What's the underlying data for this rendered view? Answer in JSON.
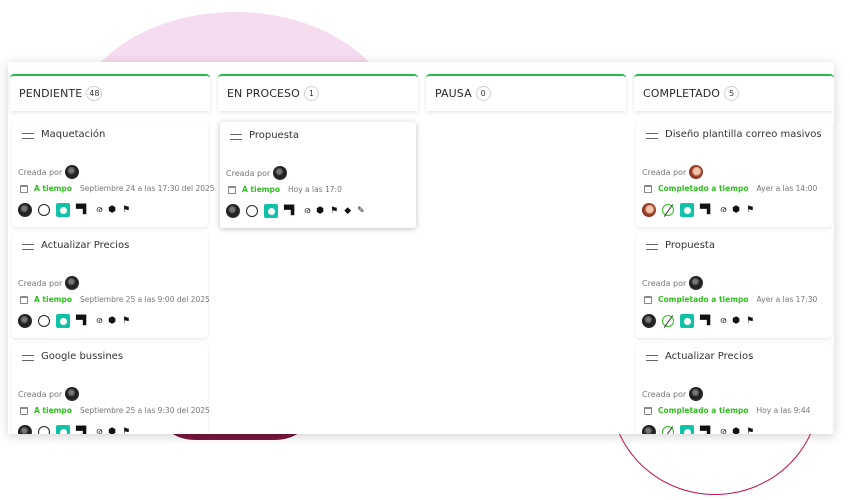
{
  "board": {
    "columns": [
      {
        "title": "PENDIENTE",
        "count": "48",
        "cards": [
          {
            "title": "Maquetación",
            "created_label": "Creada por",
            "status": "A tiempo",
            "date": "Septiembre 24 a las 17:30 del 2025",
            "completed": false
          },
          {
            "title": "Actualizar Precios",
            "created_label": "Creada por",
            "status": "A tiempo",
            "date": "Septiembre 25 a las 9:00 del 2025",
            "completed": false
          },
          {
            "title": "Google bussines",
            "created_label": "Creada por",
            "status": "A tiempo",
            "date": "Septiembre 25 a las 9:30 del 2025",
            "completed": false
          }
        ]
      },
      {
        "title": "EN PROCESO",
        "count": "1",
        "cards": [
          {
            "title": "Propuesta",
            "created_label": "Creada por",
            "status": "A tiempo",
            "date": "Hoy a las 17:0",
            "completed": false
          }
        ]
      },
      {
        "title": "PAUSA",
        "count": "0",
        "cards": []
      },
      {
        "title": "COMPLETADO",
        "count": "5",
        "cards": [
          {
            "title": "Diseño plantilla correo masivos",
            "created_label": "Creada por",
            "status": "Completado a tiempo",
            "date": "Ayer a las 14:00",
            "completed": true
          },
          {
            "title": "Propuesta",
            "created_label": "Creada por",
            "status": "Completado a tiempo",
            "date": "Ayer a las 17:30",
            "completed": true
          },
          {
            "title": "Actualizar Precios",
            "created_label": "Creada por",
            "status": "Completado a tiempo",
            "date": "Hoy a las 9:44",
            "completed": true
          }
        ]
      }
    ]
  },
  "icons": {
    "drag": "drag-handle-icon",
    "calendar": "calendar-icon",
    "avatar": "avatar-icon",
    "status_circle": "status-circle-icon",
    "play": "play-icon",
    "comment": "comment-icon",
    "bike": "bicycle-icon",
    "tag": "tag-icon",
    "flag": "flag-icon",
    "layers": "layers-icon",
    "pencil": "pencil-icon"
  },
  "colors": {
    "column_accent": "#2db84f",
    "status_green": "#2fbf1f",
    "play_teal": "#10c2a8",
    "deco_pink": "#f4d8ee",
    "deco_maroon": "#7a1640",
    "deco_circle": "#c4124e"
  }
}
